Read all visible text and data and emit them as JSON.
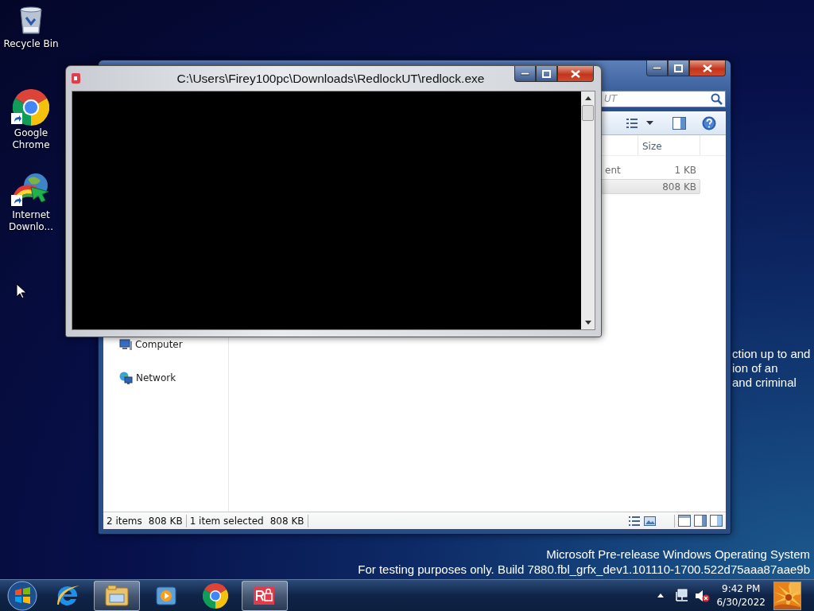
{
  "desktop_icons": [
    {
      "kind": "recycle-bin",
      "label": "Recycle Bin",
      "shortcut": false
    },
    {
      "kind": "chrome",
      "label": "Google Chrome",
      "shortcut": true
    },
    {
      "kind": "download-manager",
      "label": "Internet Downlo...",
      "shortcut": true
    }
  ],
  "desktop_note": {
    "lines": [
      "ction up to and",
      "ion of an",
      "and criminal"
    ]
  },
  "explorer": {
    "search": {
      "placeholder": "UT"
    },
    "columns": [
      "Size"
    ],
    "rows": [
      {
        "column_3": "ent",
        "size": "1 KB",
        "selected": false
      },
      {
        "size": "808 KB",
        "selected": true
      }
    ],
    "nav_items": [
      {
        "kind": "computer",
        "label": "Computer"
      },
      {
        "kind": "network",
        "label": "Network"
      }
    ],
    "status_bar": [
      {
        "texts": [
          "2 items",
          "808 KB"
        ]
      },
      {
        "texts": [
          "1 item selected",
          "808 KB"
        ]
      }
    ]
  },
  "console": {
    "title": "C:\\Users\\Firey100pc\\Downloads\\RedlockUT\\redlock.exe"
  },
  "watermark_lines": [
    "Microsoft Pre-release Windows Operating System",
    "For testing purposes only. Build 7880.fbl_grfx_dev1.101110-1700.522d75aaa87aae9b"
  ],
  "taskbar": {
    "items": [
      {
        "kind": "ie",
        "active": false
      },
      {
        "kind": "explorer",
        "active": true
      },
      {
        "kind": "media",
        "active": false
      },
      {
        "kind": "chrome",
        "active": false
      },
      {
        "kind": "redlock",
        "active": true
      }
    ],
    "clock": {
      "time": "9:42 PM",
      "date": "6/30/2022"
    }
  }
}
